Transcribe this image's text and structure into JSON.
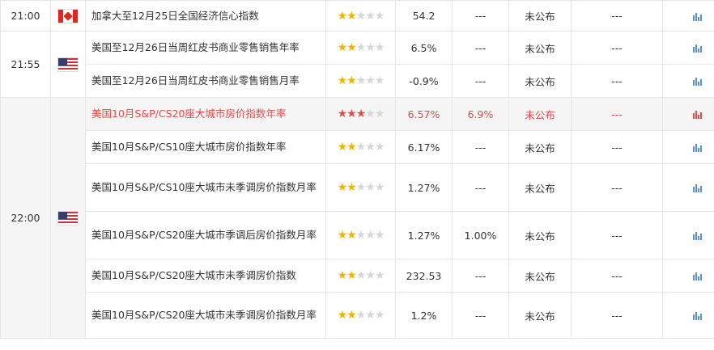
{
  "colors": {
    "highlight": "#e34b4b",
    "star_active": "#f0b400",
    "star_inactive": "#d6d6d6",
    "chart_icon": "#5b8fd6"
  },
  "groups": [
    {
      "time": "21:00",
      "flag": "canada-flag-icon",
      "rows": [
        {
          "name": "加拿大至12月25日全国经济信心指数",
          "stars": 2,
          "previous": "54.2",
          "forecast": "---",
          "actual": "未公布",
          "impact": "---",
          "highlight": false
        }
      ]
    },
    {
      "time": "21:55",
      "flag": "usa-flag-icon",
      "rows": [
        {
          "name": "美国至12月26日当周红皮书商业零售销售年率",
          "stars": 2,
          "previous": "6.5%",
          "forecast": "---",
          "actual": "未公布",
          "impact": "---",
          "highlight": false
        },
        {
          "name": "美国至12月26日当周红皮书商业零售销售月率",
          "stars": 2,
          "previous": "-0.9%",
          "forecast": "---",
          "actual": "未公布",
          "impact": "---",
          "highlight": false
        }
      ]
    },
    {
      "time": "22:00",
      "flag": "usa-flag-icon",
      "rows": [
        {
          "name": "美国10月S&P/CS20座大城市房价指数年率",
          "stars": 3,
          "previous": "6.57%",
          "forecast": "6.9%",
          "actual": "未公布",
          "impact": "---",
          "highlight": true
        },
        {
          "name": "美国10月S&P/CS10座大城市房价指数年率",
          "stars": 2,
          "previous": "6.17%",
          "forecast": "---",
          "actual": "未公布",
          "impact": "---",
          "highlight": false
        },
        {
          "name": "美国10月S&P/CS10座大城市未季调房价指数月率",
          "stars": 2,
          "previous": "1.27%",
          "forecast": "---",
          "actual": "未公布",
          "impact": "---",
          "highlight": false
        },
        {
          "name": "美国10月S&P/CS20座大城市季调后房价指数月率",
          "stars": 2,
          "previous": "1.27%",
          "forecast": "1.00%",
          "actual": "未公布",
          "impact": "---",
          "highlight": false
        },
        {
          "name": "美国10月S&P/CS20座大城市未季调房价指数",
          "stars": 2,
          "previous": "232.53",
          "forecast": "---",
          "actual": "未公布",
          "impact": "---",
          "highlight": false
        },
        {
          "name": "美国10月S&P/CS20座大城市未季调房价指数月率",
          "stars": 2,
          "previous": "1.2%",
          "forecast": "---",
          "actual": "未公布",
          "impact": "---",
          "highlight": false
        }
      ]
    }
  ]
}
